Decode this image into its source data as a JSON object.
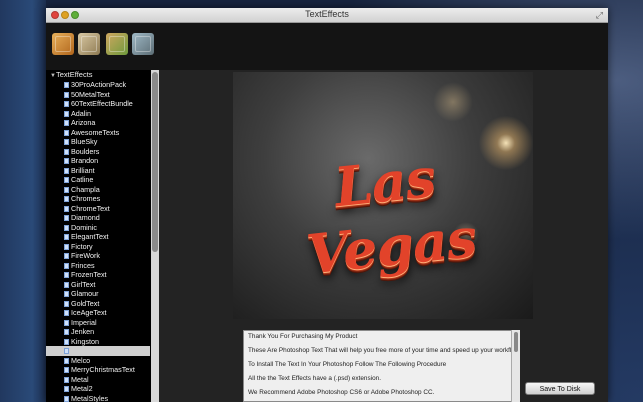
{
  "window": {
    "title": "TextEffects"
  },
  "toolbar": {
    "buttons": [
      {
        "icon": "palette-brush-icon"
      },
      {
        "icon": "tools-icon"
      },
      {
        "icon": "paint-tools-icon"
      },
      {
        "icon": "paint-bucket-icon"
      }
    ]
  },
  "sidebar": {
    "root_label": "TextEffects",
    "items": [
      "30ProActionPack",
      "50MetalText",
      "60TextEffectBundle",
      "Adalin",
      "Arizona",
      "AwesomeTexts",
      "BlueSky",
      "Boulders",
      "Brandon",
      "Brilliant",
      "Catline",
      "Champla",
      "Chromes",
      "ChromeText",
      "Diamond",
      "Dominic",
      "ElegantText",
      "Fictory",
      "FireWork",
      "Frinces",
      "FrozenText",
      "GirlText",
      "Glamour",
      "GoldText",
      "IceAgeText",
      "Imperial",
      "Jenken",
      "Kingston",
      "",
      "Melco",
      "MerryChristmasText",
      "Metal",
      "Metal2",
      "MetalStyles"
    ],
    "selected_index": 28
  },
  "preview": {
    "text": "Las Vegas"
  },
  "info": {
    "lines": [
      "Thank You For Purchasing My Product",
      "These Are Photoshop Text That will help you free more of your time and speed up your workflow",
      "To Install The Text In Your Photoshop Follow The Following Procedure",
      "All the the Text Effects have a (.psd) extension.",
      "We Recommend Adobe Photoshop CS6 or Adobe Photoshop CC."
    ]
  },
  "actions": {
    "save_label": "Save To Disk"
  }
}
